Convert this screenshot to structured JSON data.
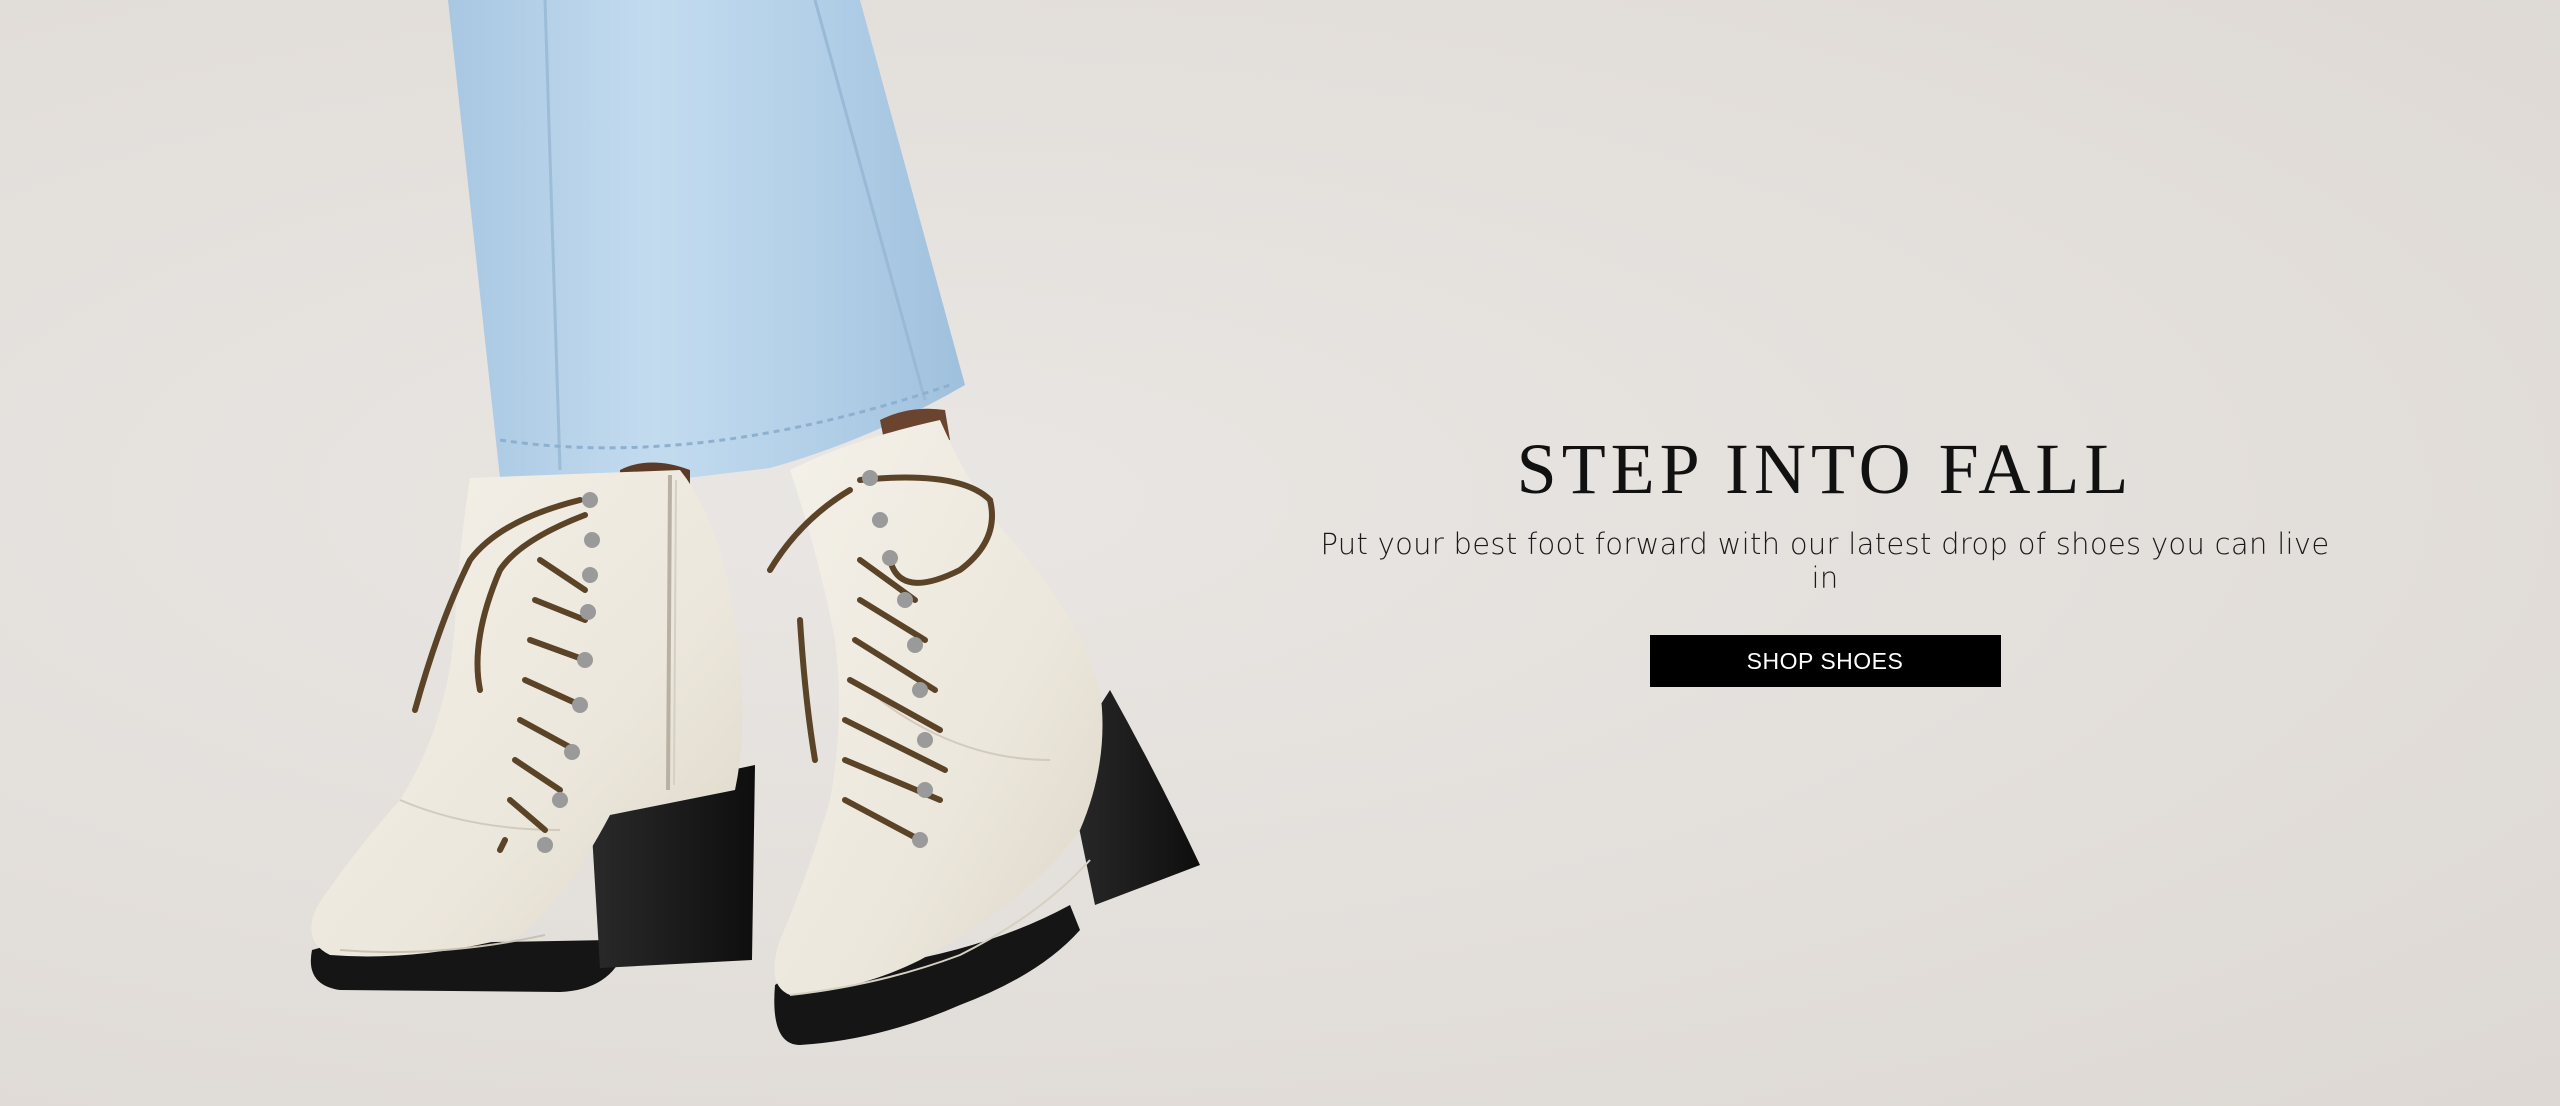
{
  "hero": {
    "title": "STEP INTO FALL",
    "subtitle": "Put your best foot forward with our latest drop of shoes you can live in",
    "cta_label": "SHOP SHOES",
    "image_subject": "white-lace-up-heeled-boots-with-light-wash-jeans"
  },
  "colors": {
    "background": "#e4e0dc",
    "title_text": "#111111",
    "button_bg": "#000000",
    "button_text": "#ffffff",
    "denim": "#b8d4ea",
    "boot_leather": "#efebe1",
    "boot_sole": "#1a1a1a",
    "laces": "#5a4326"
  }
}
